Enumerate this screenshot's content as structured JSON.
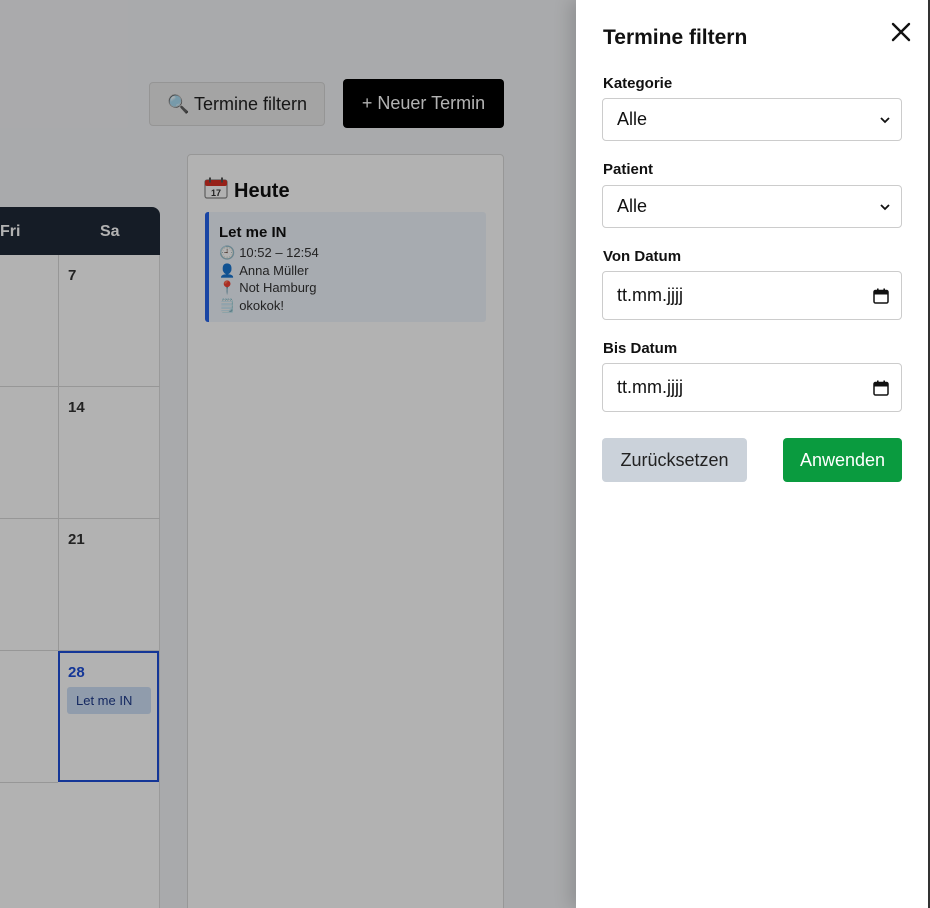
{
  "toolbar": {
    "filter_icon": "magnifier-icon",
    "filter_label": "🔍 Termine filtern",
    "new_label": "+ Neuer Termin"
  },
  "calendar": {
    "weekdays": [
      "Fri",
      "Sa"
    ],
    "days": [
      "7",
      "14",
      "21",
      "28"
    ],
    "today_event": "Let me IN"
  },
  "today_panel": {
    "icon": "calendar-icon",
    "title": "Heute",
    "event": {
      "title": "Let me IN",
      "time": "10:52 – 12:54",
      "person": "Anna Müller",
      "location": "Not Hamburg",
      "note": "okokok!"
    }
  },
  "drawer": {
    "title": "Termine filtern",
    "close_icon": "close-icon",
    "kategorie_label": "Kategorie",
    "kategorie_value": "Alle",
    "patient_label": "Patient",
    "patient_value": "Alle",
    "von_label": "Von Datum",
    "von_placeholder": "tt.mm.jjjj",
    "bis_label": "Bis Datum",
    "bis_placeholder": "tt.mm.jjjj",
    "reset_label": "Zurücksetzen",
    "apply_label": "Anwenden"
  },
  "colors": {
    "accent_blue": "#2563eb",
    "apply_green": "#0a9b3f",
    "header_dark": "#1f2937"
  }
}
